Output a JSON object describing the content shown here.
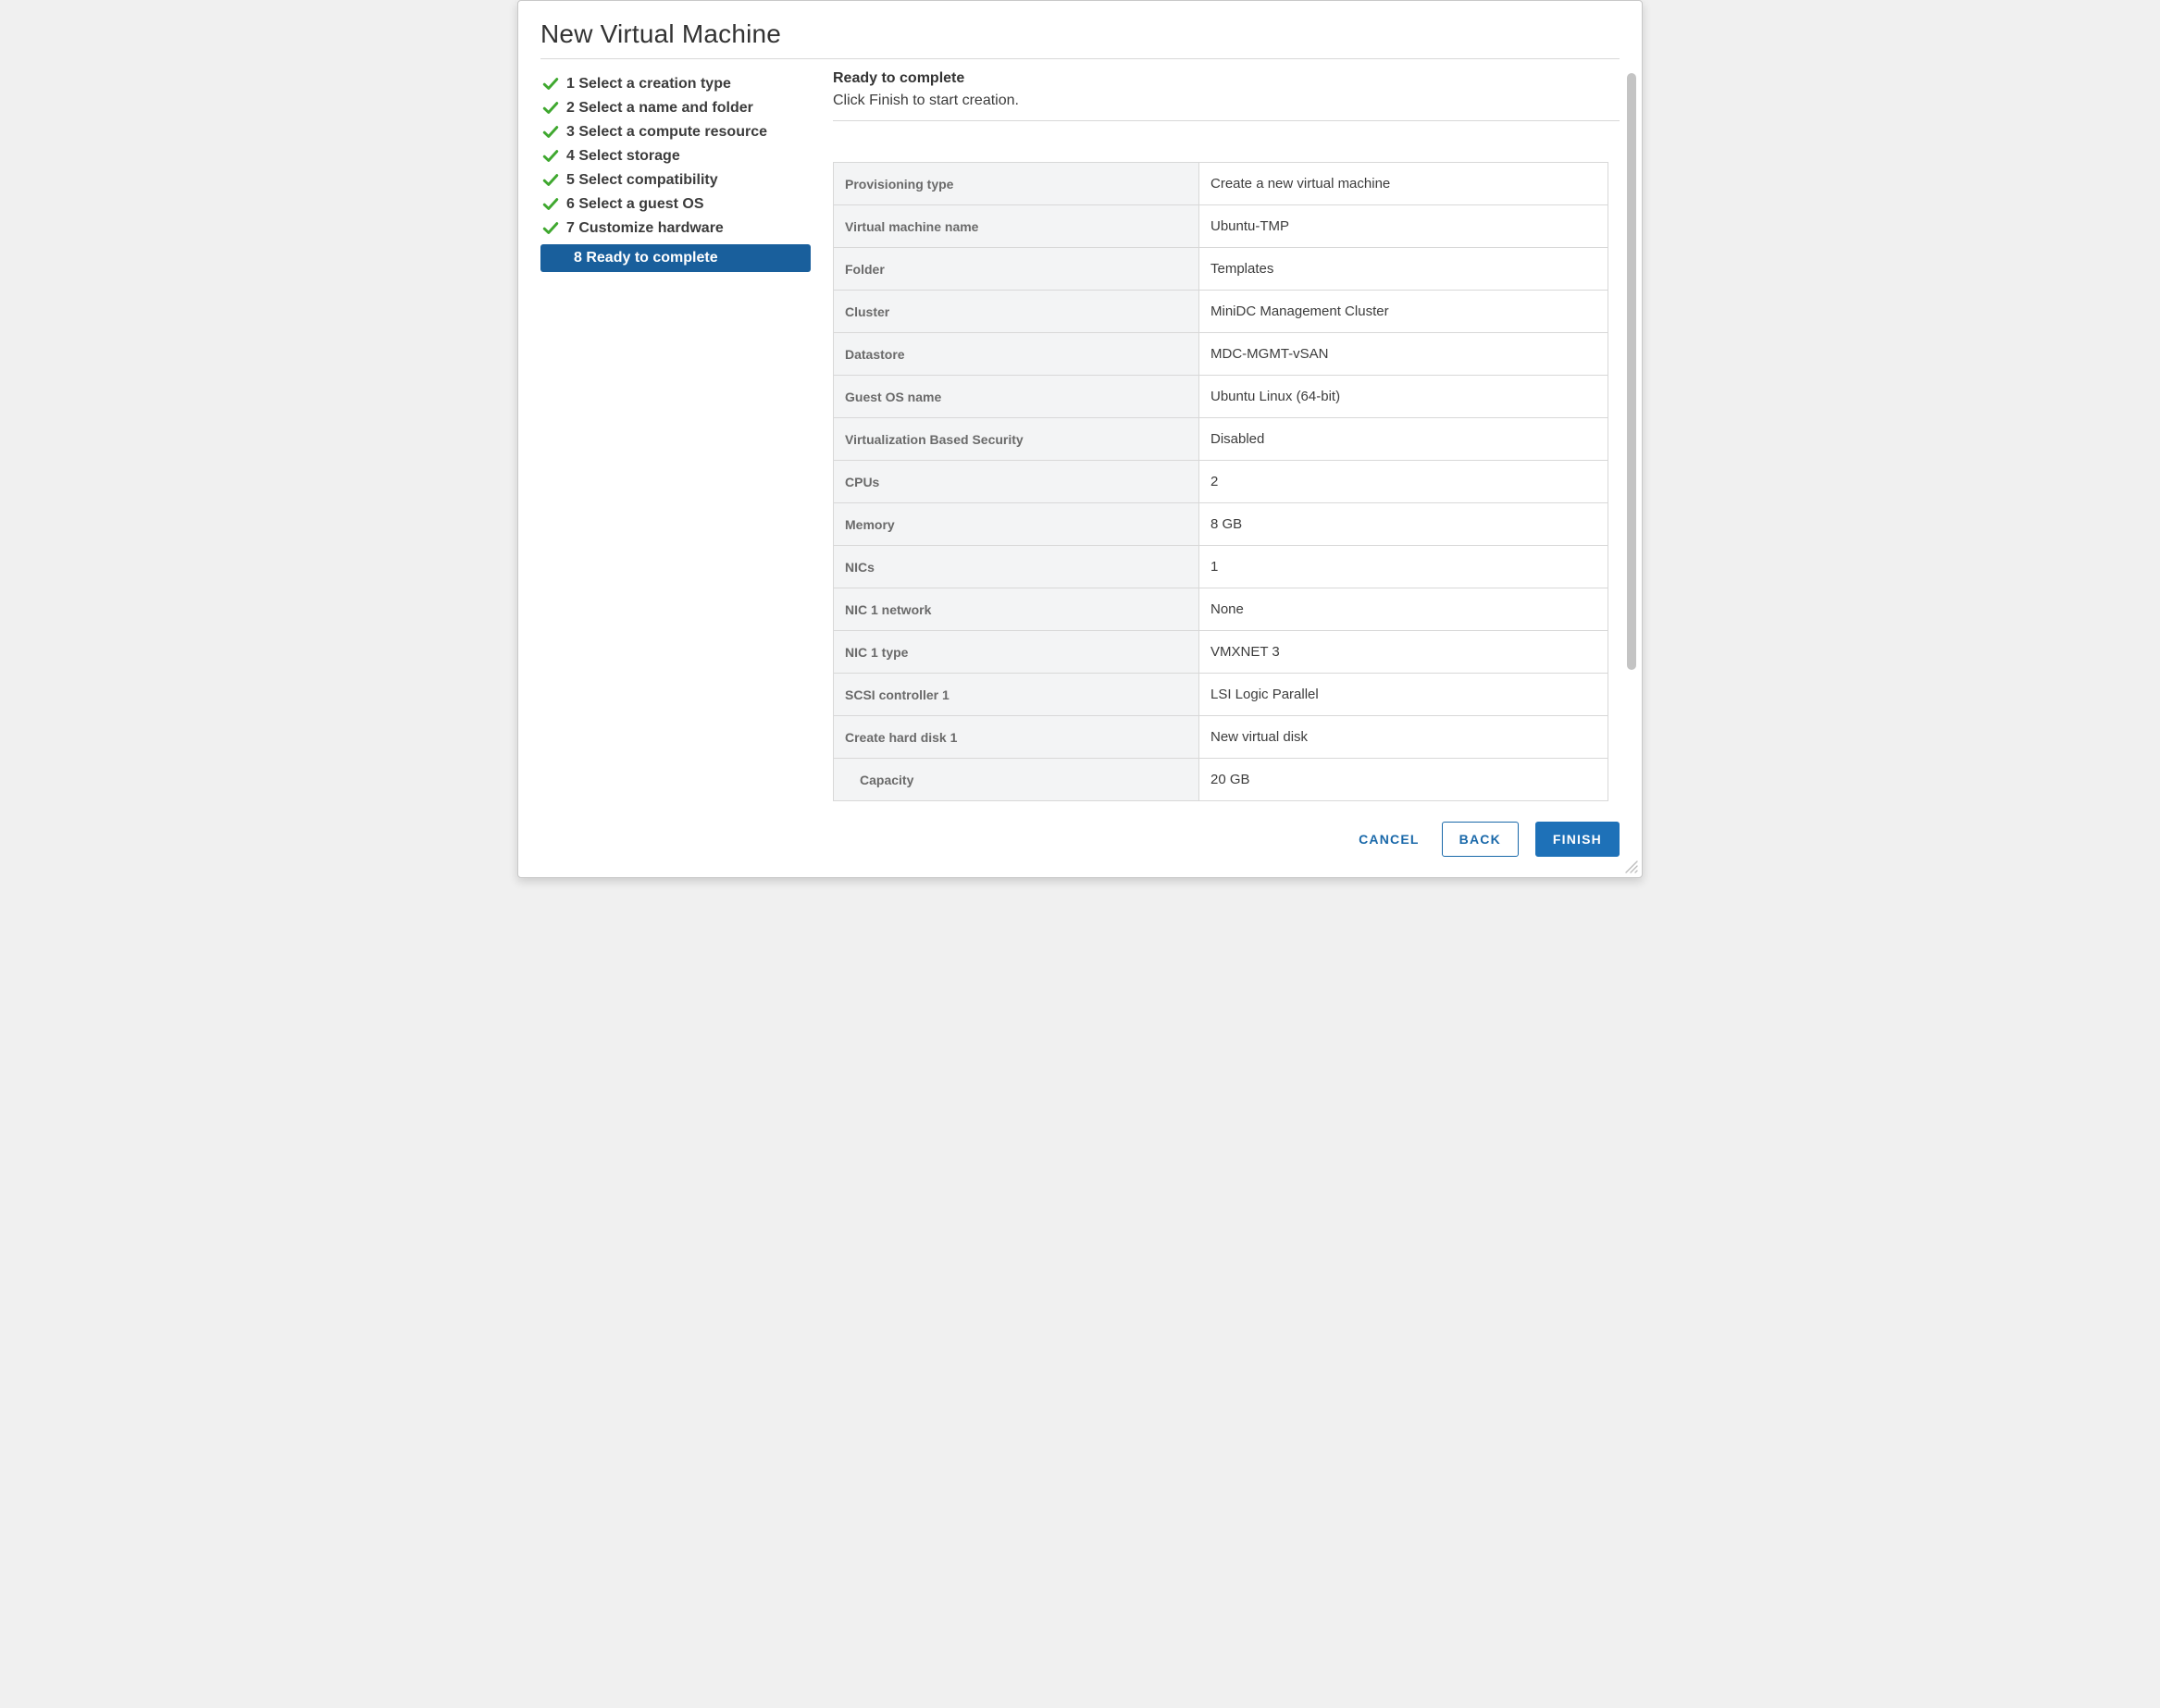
{
  "title": "New Virtual Machine",
  "steps": [
    {
      "label": "1 Select a creation type",
      "done": true,
      "current": false
    },
    {
      "label": "2 Select a name and folder",
      "done": true,
      "current": false
    },
    {
      "label": "3 Select a compute resource",
      "done": true,
      "current": false
    },
    {
      "label": "4 Select storage",
      "done": true,
      "current": false
    },
    {
      "label": "5 Select compatibility",
      "done": true,
      "current": false
    },
    {
      "label": "6 Select a guest OS",
      "done": true,
      "current": false
    },
    {
      "label": "7 Customize hardware",
      "done": true,
      "current": false
    },
    {
      "label": "8 Ready to complete",
      "done": false,
      "current": true
    }
  ],
  "panel": {
    "heading": "Ready to complete",
    "subheading": "Click Finish to start creation."
  },
  "summary": [
    {
      "label": "Provisioning type",
      "value": "Create a new virtual machine"
    },
    {
      "label": "Virtual machine name",
      "value": "Ubuntu-TMP"
    },
    {
      "label": "Folder",
      "value": "Templates"
    },
    {
      "label": "Cluster",
      "value": "MiniDC Management Cluster"
    },
    {
      "label": "Datastore",
      "value": "MDC-MGMT-vSAN"
    },
    {
      "label": "Guest OS name",
      "value": "Ubuntu Linux (64-bit)"
    },
    {
      "label": "Virtualization Based Security",
      "value": "Disabled"
    },
    {
      "label": "CPUs",
      "value": "2"
    },
    {
      "label": "Memory",
      "value": "8 GB"
    },
    {
      "label": "NICs",
      "value": "1"
    },
    {
      "label": "NIC 1 network",
      "value": "None"
    },
    {
      "label": "NIC 1 type",
      "value": "VMXNET 3"
    },
    {
      "label": "SCSI controller 1",
      "value": "LSI Logic Parallel"
    },
    {
      "label": "Create hard disk 1",
      "value": "New virtual disk"
    },
    {
      "label": "Capacity",
      "value": "20 GB",
      "indent": true
    }
  ],
  "buttons": {
    "cancel": "CANCEL",
    "back": "BACK",
    "finish": "FINISH"
  }
}
